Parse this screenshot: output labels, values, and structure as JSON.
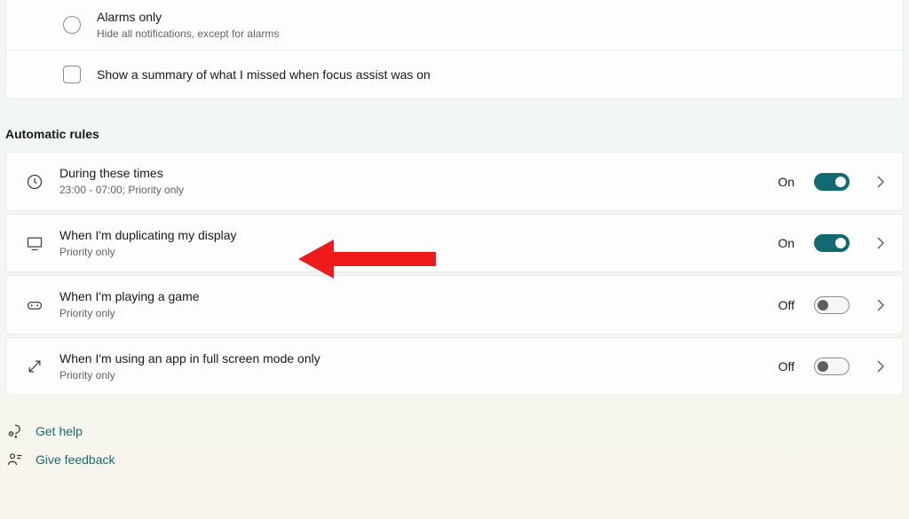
{
  "radio_option": {
    "title": "Alarms only",
    "subtitle": "Hide all notifications, except for alarms"
  },
  "summary_checkbox": {
    "label": "Show a summary of what I missed when focus assist was on"
  },
  "section_header": "Automatic rules",
  "rules": {
    "during_times": {
      "title": "During these times",
      "subtitle": "23:00 - 07:00; Priority only",
      "state": "On"
    },
    "duplicating": {
      "title": "When I'm duplicating my display",
      "subtitle": "Priority only",
      "state": "On"
    },
    "playing_game": {
      "title": "When I'm playing a game",
      "subtitle": "Priority only",
      "state": "Off"
    },
    "fullscreen": {
      "title": "When I'm using an app in full screen mode only",
      "subtitle": "Priority only",
      "state": "Off"
    }
  },
  "footer": {
    "get_help": "Get help",
    "give_feedback": "Give feedback"
  }
}
